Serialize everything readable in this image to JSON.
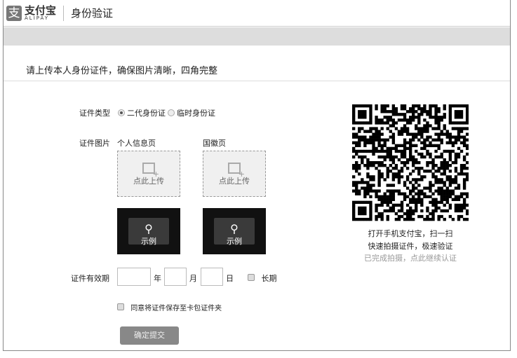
{
  "header": {
    "logo_cn": "支付宝",
    "logo_en": "ALIPAY",
    "title": "身份验证"
  },
  "intro": "请上传本人身份证件，确保图片清晰，四角完整",
  "form": {
    "type_label": "证件类型",
    "type_options": [
      "二代身份证",
      "临时身份证"
    ],
    "type_selected": "二代身份证",
    "image_label": "证件图片",
    "front_label": "个人信息页",
    "back_label": "国徽页",
    "upload_text": "点此上传",
    "sample_text": "示例",
    "validity_label": "证件有效期",
    "year": "年",
    "month": "月",
    "day": "日",
    "longterm": "长期",
    "agree": "同意将证件保存至卡包证件夹",
    "submit": "确定提交"
  },
  "qr": {
    "line1": "打开手机支付宝，扫一扫",
    "line2": "快速拍摄证件，极速验证",
    "link": "已完成拍摄，点此继续认证"
  }
}
